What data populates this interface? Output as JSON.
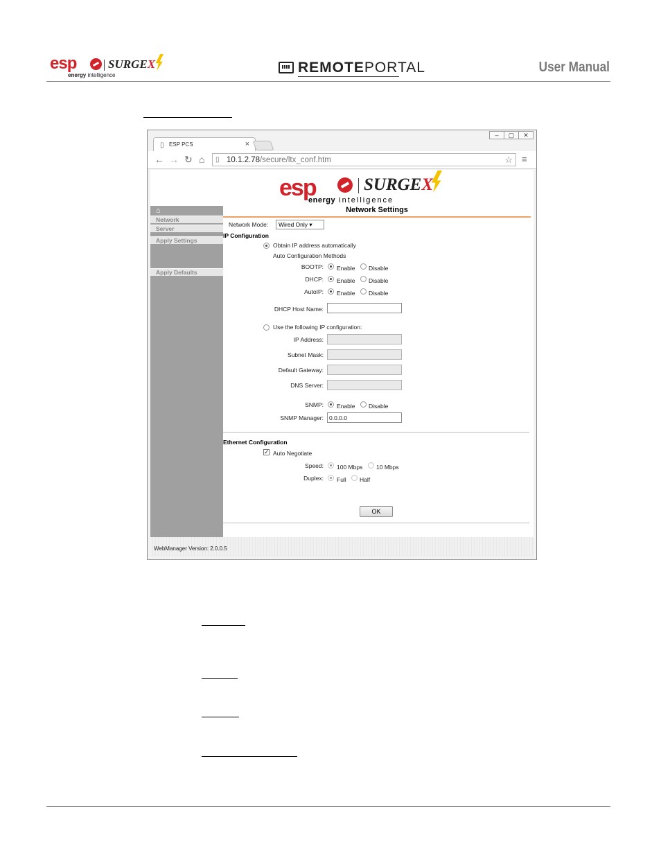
{
  "header": {
    "esp_logo_text": "esp",
    "surgex_logo_text": "SURGE",
    "surgex_x": "X",
    "energy_text_bold": "energy",
    "energy_text_rest": "intelligence",
    "remote_bold": "REMOTE",
    "remote_thin": "PORTAL",
    "manual_title": "User Manual"
  },
  "browser": {
    "tab_title": "ESP PCS",
    "tab_close": "×",
    "url_host": "10.1.2.78",
    "url_path": "/secure/ltx_conf.htm",
    "controls": [
      "‒",
      "▢",
      "✕"
    ]
  },
  "page": {
    "banner": {
      "esp": "esp",
      "surgex": "SURGE",
      "surgex_x": "X",
      "energy": "energy",
      "intelligence": "intelligence"
    },
    "title": "Network Settings",
    "sidebar": {
      "items": [
        "Network",
        "Server",
        "Apply Settings",
        "Apply Defaults"
      ]
    },
    "network_mode": {
      "label": "Network Mode:",
      "value": "Wired Only"
    },
    "ip_config": {
      "heading": "IP Configuration",
      "obtain_auto": "Obtain IP address automatically",
      "auto_methods": "Auto Configuration Methods",
      "bootp": "BOOTP:",
      "dhcp": "DHCP:",
      "autoip": "AutoIP:",
      "enable": "Enable",
      "disable": "Disable",
      "dhcp_host_name": "DHCP Host Name:",
      "use_following": "Use the following IP configuration:",
      "ip_address": "IP Address:",
      "subnet_mask": "Subnet Mask:",
      "default_gateway": "Default Gateway:",
      "dns_server": "DNS Server:",
      "snmp": "SNMP:",
      "snmp_manager": "SNMP Manager:",
      "snmp_manager_value": "0.0.0.0"
    },
    "ethernet": {
      "heading": "Ethernet Configuration",
      "auto_negotiate": "Auto Negotiate",
      "speed": "Speed:",
      "speed_100": "100 Mbps",
      "speed_10": "10 Mbps",
      "duplex": "Duplex:",
      "full": "Full",
      "half": "Half"
    },
    "ok": "OK",
    "version": "WebManager Version: 2.0.0.5"
  },
  "colors": {
    "brand_red": "#d2232a",
    "bolt_yellow": "#f3c300",
    "heading_rule": "#f0a060",
    "sidebar_gray": "#a0a0a0"
  }
}
